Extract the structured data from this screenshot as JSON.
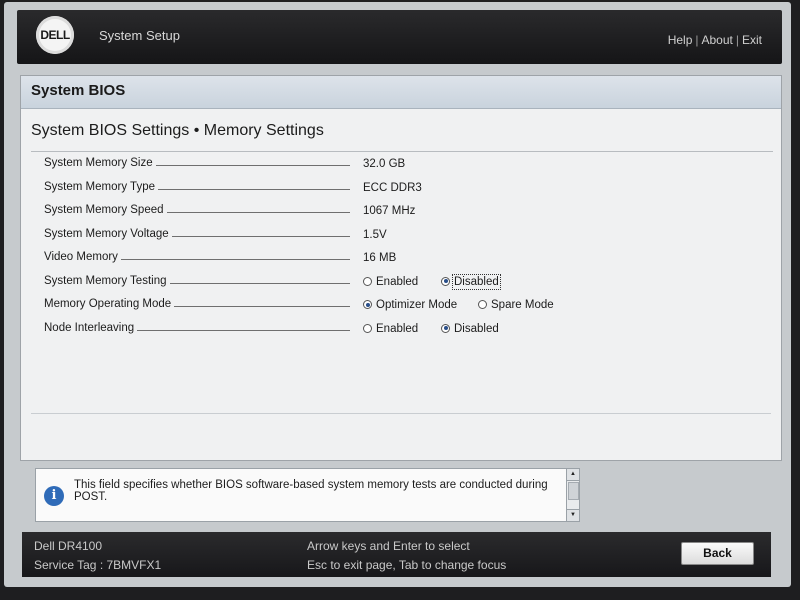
{
  "header": {
    "logo_text": "DELL",
    "app_title": "System Setup",
    "links": {
      "help": "Help",
      "about": "About",
      "exit": "Exit"
    },
    "separator": "|"
  },
  "panel": {
    "title": "System BIOS",
    "subtitle": "System BIOS Settings • Memory Settings",
    "rows": [
      {
        "label": "System Memory Size",
        "value": "32.0 GB"
      },
      {
        "label": "System Memory Type",
        "value": "ECC DDR3"
      },
      {
        "label": "System Memory Speed",
        "value": "1067 MHz"
      },
      {
        "label": "System Memory Voltage",
        "value": "1.5V"
      },
      {
        "label": "Video Memory",
        "value": "16 MB"
      },
      {
        "label": "System Memory Testing",
        "options": [
          "Enabled",
          "Disabled"
        ],
        "selected": "Disabled"
      },
      {
        "label": "Memory Operating Mode",
        "options": [
          "Optimizer Mode",
          "Spare Mode"
        ],
        "selected": "Optimizer Mode"
      },
      {
        "label": "Node Interleaving",
        "options": [
          "Enabled",
          "Disabled"
        ],
        "selected": "Disabled"
      }
    ]
  },
  "help": {
    "icon": "info-icon",
    "text": "This field specifies whether BIOS software-based system memory tests are conducted during POST."
  },
  "footer": {
    "model": "Dell DR4100",
    "service_tag": "Service Tag : 7BMVFX1",
    "hint1": "Arrow keys and Enter to select",
    "hint2": "Esc to exit page, Tab to change focus",
    "back_label": "Back"
  }
}
